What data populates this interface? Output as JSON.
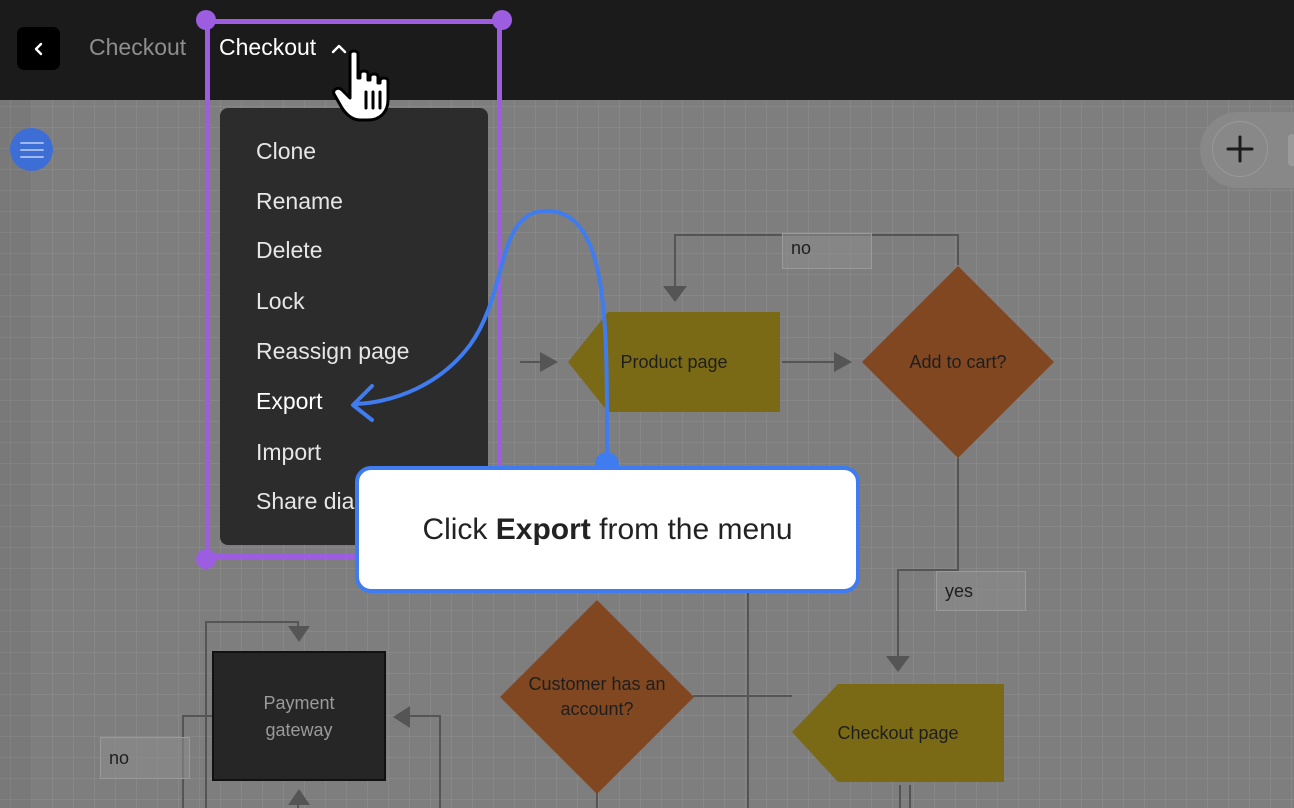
{
  "topbar": {
    "back_icon": "chevron-left-icon",
    "breadcrumb_parent": "Checkout",
    "breadcrumb_current": "Checkout",
    "current_toggle_icon": "chevron-up-icon"
  },
  "menu": {
    "items": [
      "Clone",
      "Rename",
      "Delete",
      "Lock",
      "Reassign page",
      "Export",
      "Import",
      "Share dia"
    ]
  },
  "callout": {
    "prefix": "Click ",
    "bold": "Export",
    "suffix": " from the menu"
  },
  "diagram": {
    "nodes": {
      "product_page": "Product page",
      "add_to_cart": "Add to cart?",
      "checkout_page": "Checkout page",
      "customer_account_line1": "Customer has an",
      "customer_account_line2": "account?",
      "payment_line1": "Payment",
      "payment_line2": "gateway"
    },
    "edge_labels": {
      "no_top": "no",
      "yes": "yes",
      "no_left": "no"
    }
  },
  "colors": {
    "highlight": "#9d5de0",
    "callout_border": "#3f7cf0",
    "page_node": "#7a6a16",
    "decision_node": "#804721",
    "terminal_node": "#262626"
  }
}
